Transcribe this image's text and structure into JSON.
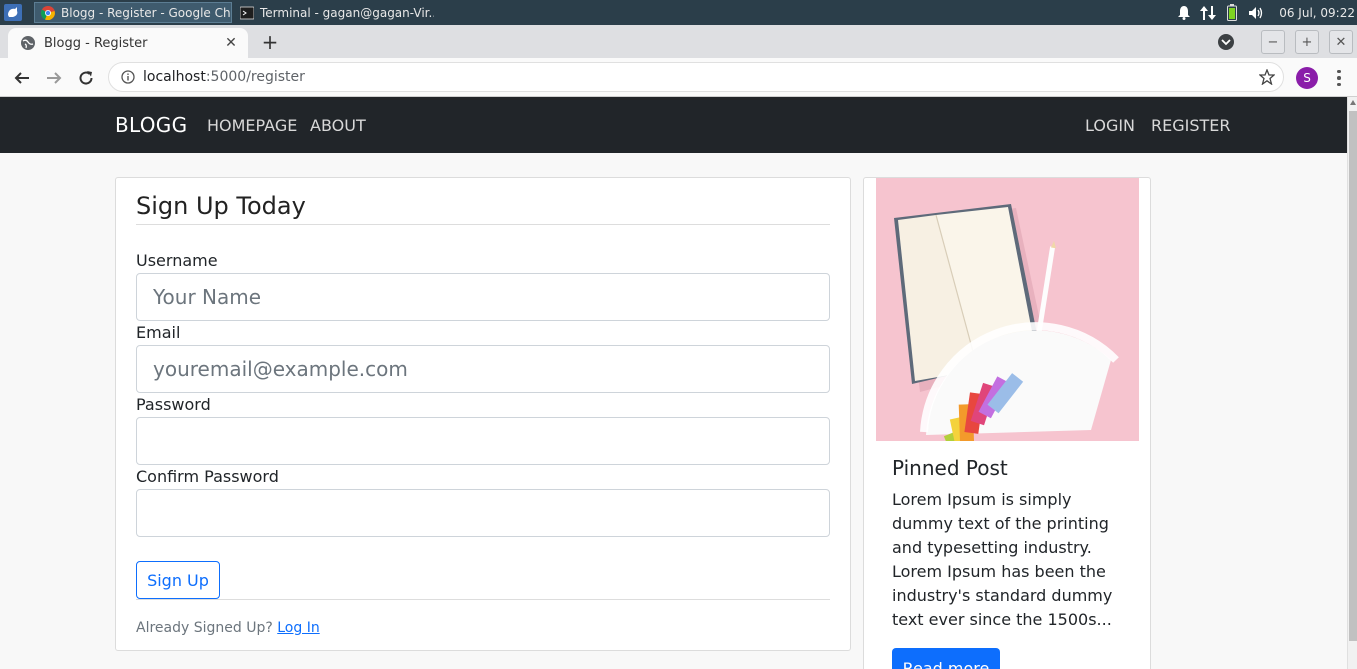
{
  "taskbar": {
    "tasks": [
      {
        "label": "Blogg - Register - Google Chr...",
        "icon": "chrome-icon"
      },
      {
        "label": "Terminal - gagan@gagan-Vir...",
        "icon": "terminal-icon"
      }
    ],
    "clock": "06 Jul, 09:22"
  },
  "browser": {
    "tab_title": "Blogg - Register",
    "url_host": "localhost",
    "url_path": ":5000/register",
    "profile_initial": "S"
  },
  "site": {
    "brand": "BLOGG",
    "nav_left": [
      "HOMEPAGE",
      "ABOUT"
    ],
    "nav_right": [
      "LOGIN",
      "REGISTER"
    ]
  },
  "form": {
    "title": "Sign Up Today",
    "username_label": "Username",
    "username_placeholder": "Your Name",
    "email_label": "Email",
    "email_placeholder": "youremail@example.com",
    "password_label": "Password",
    "confirm_label": "Confirm Password",
    "submit_label": "Sign Up",
    "already_text": "Already Signed Up?",
    "login_link": "Log In"
  },
  "sidebar": {
    "title": "Pinned Post",
    "text": "Lorem Ipsum is simply dummy text of the printing and typesetting industry. Lorem Ipsum has been the industry's standard dummy text ever since the 1500s...",
    "button": "Read more"
  },
  "colors": {
    "navbar": "#212529",
    "primary": "#0d6efd",
    "taskbar": "#2b3e4a"
  }
}
